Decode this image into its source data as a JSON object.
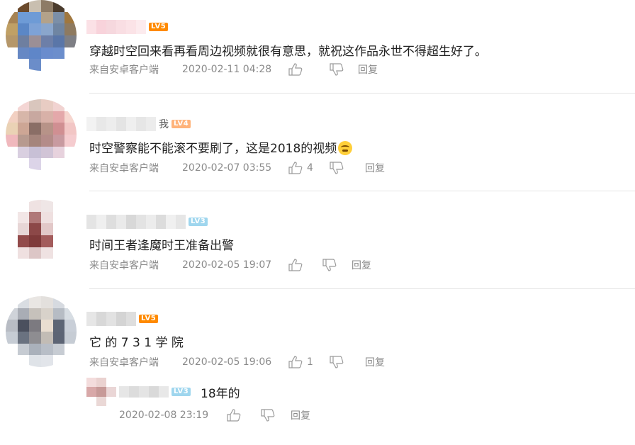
{
  "comments": [
    {
      "level": "LV5",
      "text": "穿越时空回来看再看周边视频就很有意思，就祝这作品永世不得超生好了。",
      "source": "来自安卓客户端",
      "time": "2020-02-11 04:28",
      "likes": "",
      "reply": "回复"
    },
    {
      "level": "LV4",
      "name_tail": "我",
      "text": "时空警察能不能滚不要刷了，这是2018的视频",
      "source": "来自安卓客户端",
      "time": "2020-02-07 03:55",
      "likes": "4",
      "reply": "回复"
    },
    {
      "level": "LV3",
      "text": "时间王者逢魔时王准备出警",
      "source": "来自安卓客户端",
      "time": "2020-02-05 19:07",
      "likes": "",
      "reply": "回复"
    },
    {
      "level": "LV5",
      "text": "它 的 7 3 1 学 院",
      "source": "来自安卓客户端",
      "time": "2020-02-05 19:06",
      "likes": "1",
      "reply": "回复"
    }
  ],
  "subreply": {
    "level": "LV3",
    "text": "18年的",
    "time": "2020-02-08 23:19",
    "reply": "回复"
  },
  "colors": {
    "level_orange": "#ff8a00",
    "level_peach": "#ffb37a",
    "level_blue": "#9fd6ee",
    "meta_gray": "#8a8a8a"
  },
  "icons": [
    "thumb-up-icon",
    "thumb-down-icon",
    "emoji-icon"
  ]
}
